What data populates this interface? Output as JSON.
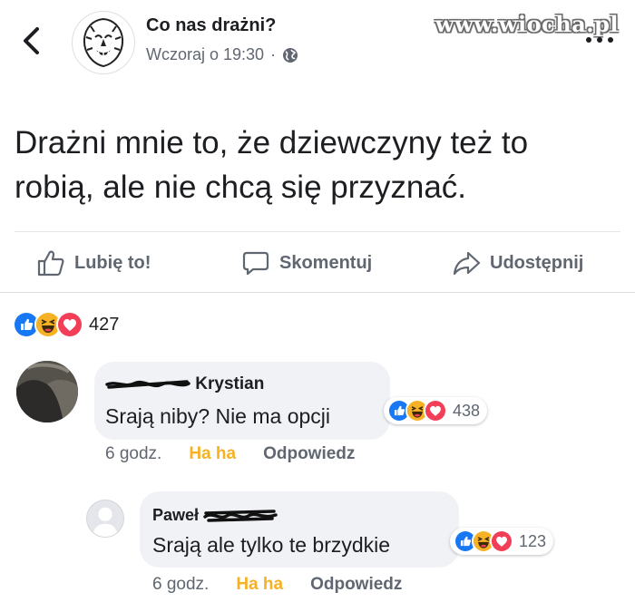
{
  "header": {
    "page_name": "Co nas drażni?",
    "post_time": "Wczoraj o 19:30",
    "separator": "·",
    "watermark": "www.wiocha.pl"
  },
  "post": {
    "text": "Drażni mnie to, że dziewczyny też to robią, ale nie chcą się przyznać."
  },
  "actions": {
    "like_label": "Lubię to!",
    "comment_label": "Skomentuj",
    "share_label": "Udostępnij"
  },
  "reactions": {
    "total": "427",
    "types": [
      "like",
      "haha",
      "love"
    ]
  },
  "comments": [
    {
      "author_visible": "Krystian",
      "text": "Srają niby? Nie ma opcji",
      "reaction_count": "438",
      "time": "6 godz.",
      "reaction_link": "Ha ha",
      "reply_link": "Odpowiedz"
    },
    {
      "author_visible": "Paweł",
      "text": "Srają ale tylko te brzydkie",
      "reaction_count": "123",
      "time": "6 godz.",
      "reaction_link": "Ha ha",
      "reply_link": "Odpowiedz"
    }
  ],
  "colors": {
    "like_blue": "#1877f2",
    "love_red": "#f33e58",
    "haha_yellow": "#f7b125",
    "meta_grey": "#606770"
  }
}
